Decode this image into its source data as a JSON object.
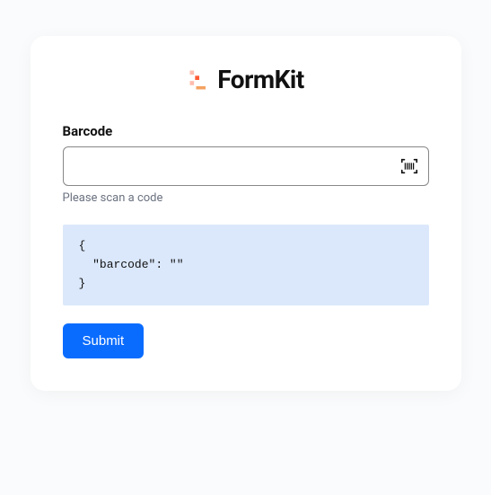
{
  "brand": {
    "name": "FormKit"
  },
  "form": {
    "barcode": {
      "label": "Barcode",
      "value": "",
      "help": "Please scan a code"
    },
    "preview_json": "{\n  \"barcode\": \"\"\n}",
    "submit_label": "Submit"
  }
}
